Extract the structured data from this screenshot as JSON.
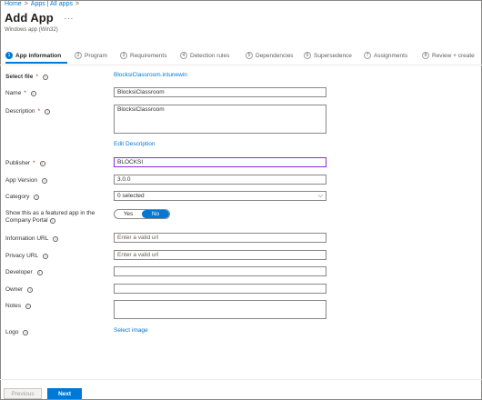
{
  "breadcrumb": {
    "home": "Home",
    "sep1": ">",
    "apps": "Apps | All apps",
    "sep2": ">"
  },
  "header": {
    "title": "Add App",
    "more": "...",
    "subtitle": "Windows app (Win32)"
  },
  "steps": [
    {
      "num": "1",
      "label": "App information",
      "active": true
    },
    {
      "num": "2",
      "label": "Program"
    },
    {
      "num": "3",
      "label": "Requirements"
    },
    {
      "num": "4",
      "label": "Detection rules"
    },
    {
      "num": "5",
      "label": "Dependencies"
    },
    {
      "num": "6",
      "label": "Supersedence"
    },
    {
      "num": "7",
      "label": "Assignments"
    },
    {
      "num": "8",
      "label": "Review + create"
    }
  ],
  "form": {
    "select_file": {
      "label": "Select file",
      "value": "BlocksiClassroom.intunewin"
    },
    "name": {
      "label": "Name",
      "value": "BlocksiClassroom"
    },
    "description": {
      "label": "Description",
      "value": "BlocksiClassroom"
    },
    "edit_description": "Edit Description",
    "publisher": {
      "label": "Publisher",
      "value": "BLOCKSI"
    },
    "app_version": {
      "label": "App Version",
      "value": "3.0.0"
    },
    "category": {
      "label": "Category",
      "value": "0 selected"
    },
    "featured": {
      "label_line1": "Show this as a featured app in the",
      "label_line2": "Company Portal",
      "yes": "Yes",
      "no": "No",
      "selected": "No"
    },
    "information_url": {
      "label": "Information URL",
      "placeholder": "Enter a valid url"
    },
    "privacy_url": {
      "label": "Privacy URL",
      "placeholder": "Enter a valid url"
    },
    "developer": {
      "label": "Developer",
      "value": ""
    },
    "owner": {
      "label": "Owner",
      "value": ""
    },
    "notes": {
      "label": "Notes",
      "value": ""
    },
    "logo": {
      "label": "Logo",
      "link": "Select image"
    }
  },
  "footer": {
    "previous": "Previous",
    "next": "Next"
  },
  "info_glyph": "i",
  "required_mark": "*",
  "chevron": "⌵",
  "colors": {
    "accent": "#0078d4",
    "required": "#a4262c",
    "publisher_border": "#8a2be2"
  }
}
